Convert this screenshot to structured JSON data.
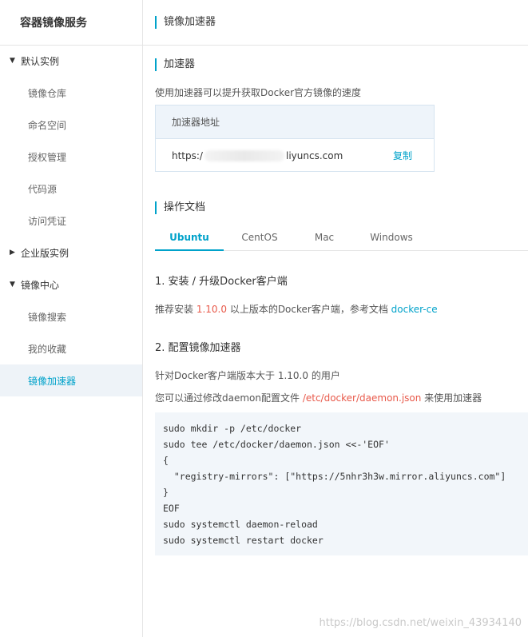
{
  "sidebar": {
    "title": "容器镜像服务",
    "items": [
      {
        "label": "默认实例",
        "type": "group",
        "expanded": true
      },
      {
        "label": "镜像仓库",
        "type": "child"
      },
      {
        "label": "命名空间",
        "type": "child"
      },
      {
        "label": "授权管理",
        "type": "child"
      },
      {
        "label": "代码源",
        "type": "child"
      },
      {
        "label": "访问凭证",
        "type": "child"
      },
      {
        "label": "企业版实例",
        "type": "group",
        "expanded": false
      },
      {
        "label": "镜像中心",
        "type": "group",
        "expanded": true
      },
      {
        "label": "镜像搜索",
        "type": "child"
      },
      {
        "label": "我的收藏",
        "type": "child"
      },
      {
        "label": "镜像加速器",
        "type": "child",
        "active": true
      }
    ],
    "caret_expanded": "▼",
    "caret_collapsed": "▶"
  },
  "header": {
    "title": "镜像加速器"
  },
  "accelerator": {
    "section_title": "加速器",
    "description": "使用加速器可以提升获取Docker官方镜像的速度",
    "table_header": "加速器地址",
    "url_prefix": "https:/",
    "url_suffix": "liyuncs.com",
    "copy_label": "复制"
  },
  "docs": {
    "section_title": "操作文档",
    "tabs": [
      {
        "label": "Ubuntu",
        "active": true
      },
      {
        "label": "CentOS",
        "active": false
      },
      {
        "label": "Mac",
        "active": false
      },
      {
        "label": "Windows",
        "active": false
      }
    ],
    "step1": {
      "title": "1. 安装 / 升级Docker客户端",
      "text_before": "推荐安装 ",
      "version": "1.10.0",
      "text_after": " 以上版本的Docker客户端，参考文档 ",
      "link": "docker-ce"
    },
    "step2": {
      "title": "2. 配置镜像加速器",
      "line1": "针对Docker客户端版本大于 1.10.0 的用户",
      "line2_before": "您可以通过修改daemon配置文件 ",
      "line2_path": "/etc/docker/daemon.json",
      "line2_after": " 来使用加速器"
    },
    "code": [
      "sudo mkdir -p /etc/docker",
      "sudo tee /etc/docker/daemon.json <<-'EOF'",
      "{",
      "  \"registry-mirrors\": [\"https://5nhr3h3w.mirror.aliyuncs.com\"]",
      "}",
      "EOF",
      "sudo systemctl daemon-reload",
      "sudo systemctl restart docker"
    ]
  },
  "watermark": "https://blog.csdn.net/weixin_43934140",
  "colors": {
    "accent": "#00a2ca",
    "highlight_red": "#e8594a",
    "active_bg": "#eef3f8",
    "code_bg": "#f2f6fa"
  }
}
